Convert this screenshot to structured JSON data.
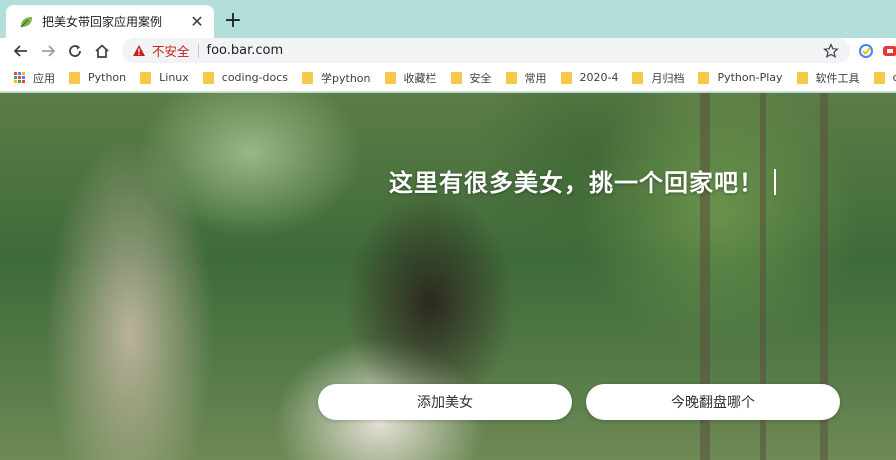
{
  "tab": {
    "title": "把美女带回家应用案例",
    "favicon": "leaf-icon",
    "close": "✕"
  },
  "new_tab_label": "+",
  "toolbar": {
    "back": "back-arrow-icon",
    "forward": "forward-arrow-icon",
    "reload": "reload-icon",
    "home": "home-icon",
    "insecure_label": "不安全",
    "url": "foo.bar.com",
    "bookmark_star": "star-icon"
  },
  "bookmarks": {
    "apps_label": "应用",
    "items": [
      "Python",
      "Linux",
      "coding-docs",
      "学python",
      "收藏栏",
      "安全",
      "常用",
      "2020-4",
      "月归档",
      "Python-Play",
      "软件工具",
      "cmit"
    ]
  },
  "page": {
    "headline": "这里有很多美女，挑一个回家吧！",
    "add_button": "添加美女",
    "pick_button": "今晚翻盘哪个"
  },
  "colors": {
    "tab_strip": "#b3dfda",
    "insecure": "#c5221f",
    "folder": "#f7c948"
  }
}
